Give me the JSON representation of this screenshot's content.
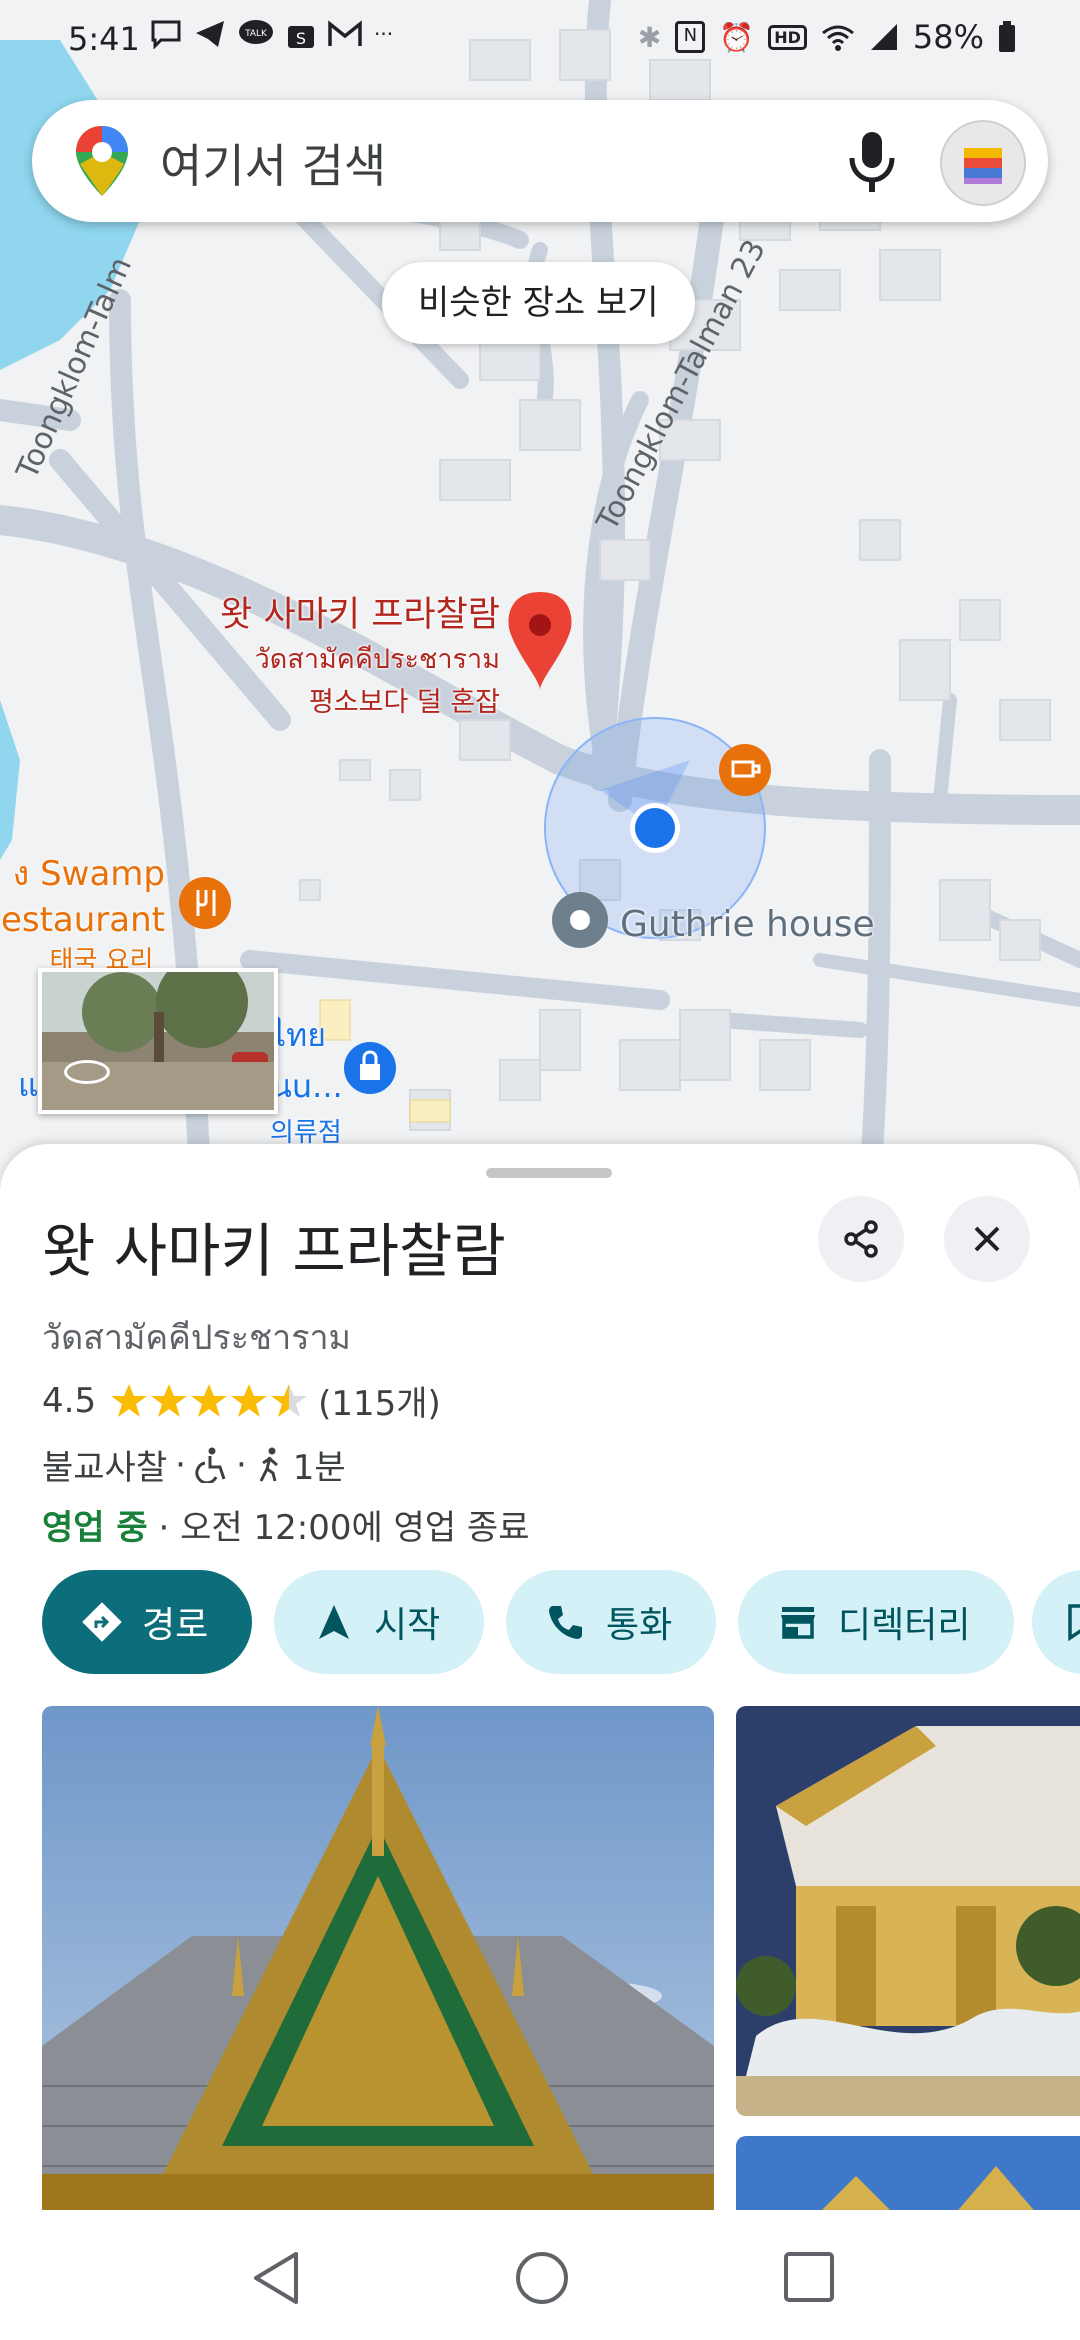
{
  "status_bar": {
    "time": "5:41",
    "more": "···",
    "battery": "58%"
  },
  "search": {
    "placeholder": "여기서 검색"
  },
  "similar_places_label": "비슷한 장소 보기",
  "map": {
    "streets": [
      {
        "label": "Toongklom-Talman 23"
      },
      {
        "label": "Toongklom-Talm"
      }
    ],
    "selected_pin": {
      "name_ko": "왓 사마키 프라찰람",
      "name_th": "วัดสามัคคีประชาราม",
      "crowd": "평소보다 덜 혼잡"
    },
    "pois": [
      {
        "label": "Guthrie house"
      },
      {
        "label_line1": "ง Swamp",
        "label_line2": "estaurant",
        "sub": "태국 요리"
      },
      {
        "label_line1": "ไทย",
        "label_line2": "นu...",
        "prefix": "แ",
        "sub": "의류점"
      }
    ]
  },
  "place": {
    "title": "왓 사마키 프라찰람",
    "subtitle": "วัดสามัคคีประชาราม",
    "rating": "4.5",
    "rating_value": 4.5,
    "reviews": "(115개)",
    "category": "불교사찰",
    "sep": "·",
    "walk_time": "1분",
    "open_status": "영업 중",
    "hours": "· 오전 12:00에 영업 종료"
  },
  "actions": [
    {
      "label": "경로",
      "icon": "directions-icon"
    },
    {
      "label": "시작",
      "icon": "navigation-arrow-icon"
    },
    {
      "label": "통화",
      "icon": "phone-icon"
    },
    {
      "label": "디렉터리",
      "icon": "store-icon"
    }
  ],
  "colors": {
    "primary_button": "#0b6e7a",
    "chip": "#d3f1f7",
    "open_green": "#188038",
    "pin_red": "#ea4335",
    "label_red": "#b3261e",
    "poi_orange": "#e8710a",
    "poi_blue": "#1a73e8",
    "star": "#fbbc04"
  }
}
